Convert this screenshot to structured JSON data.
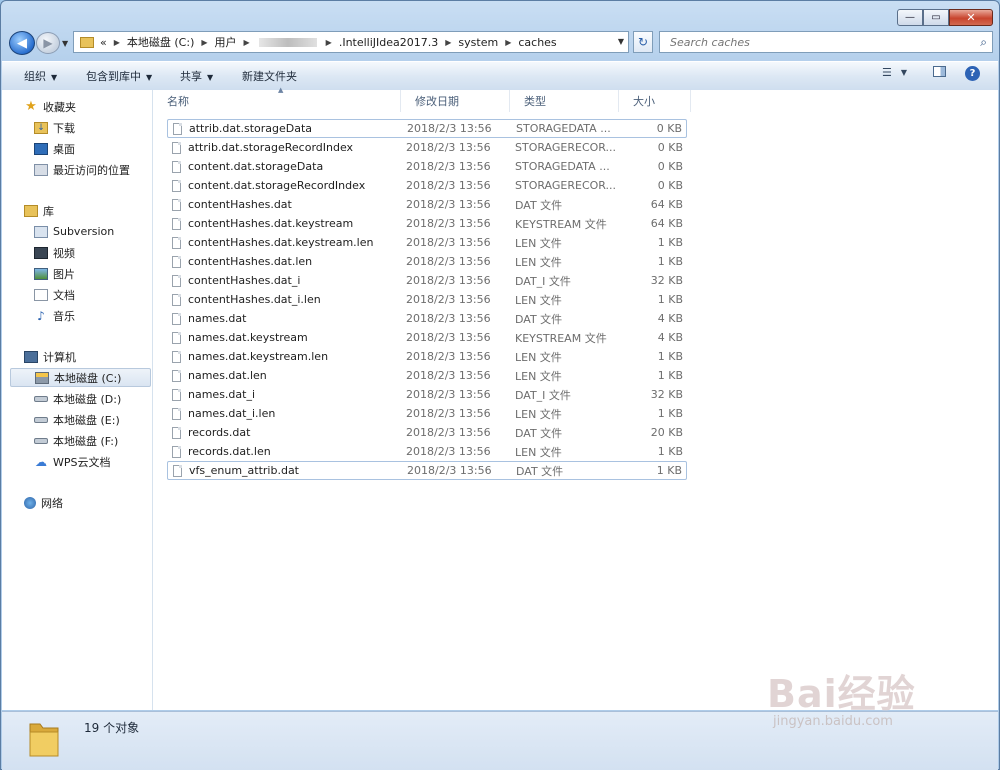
{
  "window": {
    "controls": [
      "—",
      "▭",
      "✕"
    ]
  },
  "address": {
    "back_glyph": "◀",
    "fwd_glyph": "▶",
    "chevron": "«",
    "crumbs": [
      "本地磁盘 (C:)",
      "用户",
      "",
      ".IntelliJIdea2017.3",
      "system",
      "caches"
    ]
  },
  "search": {
    "placeholder": "Search caches"
  },
  "toolbar": {
    "organize": "组织",
    "include_library": "包含到库中",
    "share": "共享",
    "new_folder": "新建文件夹"
  },
  "sidebar": {
    "favorites": {
      "label": "收藏夹",
      "items": [
        "下载",
        "桌面",
        "最近访问的位置"
      ]
    },
    "libraries": {
      "label": "库",
      "items": [
        "Subversion",
        "视频",
        "图片",
        "文档",
        "音乐"
      ]
    },
    "computer": {
      "label": "计算机",
      "items": [
        "本地磁盘 (C:)",
        "本地磁盘 (D:)",
        "本地磁盘 (E:)",
        "本地磁盘 (F:)",
        "WPS云文档"
      ]
    },
    "network": {
      "label": "网络"
    }
  },
  "columns": {
    "name": "名称",
    "date": "修改日期",
    "type": "类型",
    "size": "大小"
  },
  "files": [
    {
      "name": "attrib.dat.storageData",
      "date": "2018/2/3 13:56",
      "type": "STORAGEDATA ...",
      "size": "0 KB"
    },
    {
      "name": "attrib.dat.storageRecordIndex",
      "date": "2018/2/3 13:56",
      "type": "STORAGERECOR...",
      "size": "0 KB"
    },
    {
      "name": "content.dat.storageData",
      "date": "2018/2/3 13:56",
      "type": "STORAGEDATA ...",
      "size": "0 KB"
    },
    {
      "name": "content.dat.storageRecordIndex",
      "date": "2018/2/3 13:56",
      "type": "STORAGERECOR...",
      "size": "0 KB"
    },
    {
      "name": "contentHashes.dat",
      "date": "2018/2/3 13:56",
      "type": "DAT 文件",
      "size": "64 KB"
    },
    {
      "name": "contentHashes.dat.keystream",
      "date": "2018/2/3 13:56",
      "type": "KEYSTREAM 文件",
      "size": "64 KB"
    },
    {
      "name": "contentHashes.dat.keystream.len",
      "date": "2018/2/3 13:56",
      "type": "LEN 文件",
      "size": "1 KB"
    },
    {
      "name": "contentHashes.dat.len",
      "date": "2018/2/3 13:56",
      "type": "LEN 文件",
      "size": "1 KB"
    },
    {
      "name": "contentHashes.dat_i",
      "date": "2018/2/3 13:56",
      "type": "DAT_I 文件",
      "size": "32 KB"
    },
    {
      "name": "contentHashes.dat_i.len",
      "date": "2018/2/3 13:56",
      "type": "LEN 文件",
      "size": "1 KB"
    },
    {
      "name": "names.dat",
      "date": "2018/2/3 13:56",
      "type": "DAT 文件",
      "size": "4 KB"
    },
    {
      "name": "names.dat.keystream",
      "date": "2018/2/3 13:56",
      "type": "KEYSTREAM 文件",
      "size": "4 KB"
    },
    {
      "name": "names.dat.keystream.len",
      "date": "2018/2/3 13:56",
      "type": "LEN 文件",
      "size": "1 KB"
    },
    {
      "name": "names.dat.len",
      "date": "2018/2/3 13:56",
      "type": "LEN 文件",
      "size": "1 KB"
    },
    {
      "name": "names.dat_i",
      "date": "2018/2/3 13:56",
      "type": "DAT_I 文件",
      "size": "32 KB"
    },
    {
      "name": "names.dat_i.len",
      "date": "2018/2/3 13:56",
      "type": "LEN 文件",
      "size": "1 KB"
    },
    {
      "name": "records.dat",
      "date": "2018/2/3 13:56",
      "type": "DAT 文件",
      "size": "20 KB"
    },
    {
      "name": "records.dat.len",
      "date": "2018/2/3 13:56",
      "type": "LEN 文件",
      "size": "1 KB"
    },
    {
      "name": "vfs_enum_attrib.dat",
      "date": "2018/2/3 13:56",
      "type": "DAT 文件",
      "size": "1 KB"
    }
  ],
  "status": {
    "count_text": "19 个对象"
  },
  "watermark": {
    "main": "Bai经验",
    "sub": "jingyan.baidu.com"
  },
  "colors": {
    "frame": "#b5d0ec",
    "selection_border": "#a9c2e0",
    "accent": "#2a6fcf"
  }
}
